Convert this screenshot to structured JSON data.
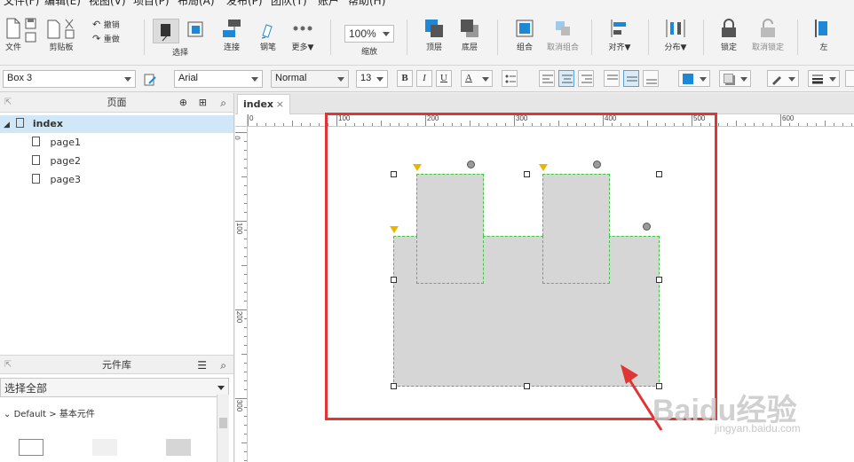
{
  "menu": [
    "文件(F)",
    "编辑(E)",
    "视图(V)",
    "项目(P)",
    "布局(A)",
    "发布(P)",
    "团队(T)",
    "账户",
    "帮助(H)"
  ],
  "toolbar": {
    "file": "文件",
    "clipboard": "剪贴板",
    "undo": "撤销",
    "redo": "重做",
    "select": "选择",
    "connect": "连接",
    "pen": "钢笔",
    "more": "更多▼",
    "zoom_value": "100%",
    "zoom": "缩放",
    "top": "顶层",
    "bottom": "底层",
    "group": "组合",
    "ungroup": "取消组合",
    "align": "对齐▼",
    "distribute": "分布▼",
    "lock": "锁定",
    "unlock": "取消锁定",
    "left": "左"
  },
  "format": {
    "widget_name": "Box 3",
    "font": "Arial",
    "style": "Normal",
    "size": "13",
    "bold": "B",
    "italic": "I",
    "underline": "U",
    "font_color": "A"
  },
  "pages_panel": {
    "title": "页面",
    "items": [
      {
        "label": "index"
      },
      {
        "label": "page1"
      },
      {
        "label": "page2"
      },
      {
        "label": "page3"
      }
    ]
  },
  "library_panel": {
    "title": "元件库",
    "filter": "选择全部",
    "path": "Default > 基本元件"
  },
  "canvas": {
    "tab": "index",
    "ruler_h": [
      "0",
      "100",
      "200",
      "300",
      "400",
      "500",
      "600"
    ],
    "ruler_v": [
      "0",
      "100",
      "200",
      "300"
    ]
  },
  "watermark": {
    "text": "Baidu经验",
    "url": "jingyan.baidu.com"
  },
  "colors": {
    "accent": "#1e88d6",
    "highlight_frame": "#e03535",
    "selection": "#3cc83c",
    "box_fill": "#d6d6d6"
  }
}
